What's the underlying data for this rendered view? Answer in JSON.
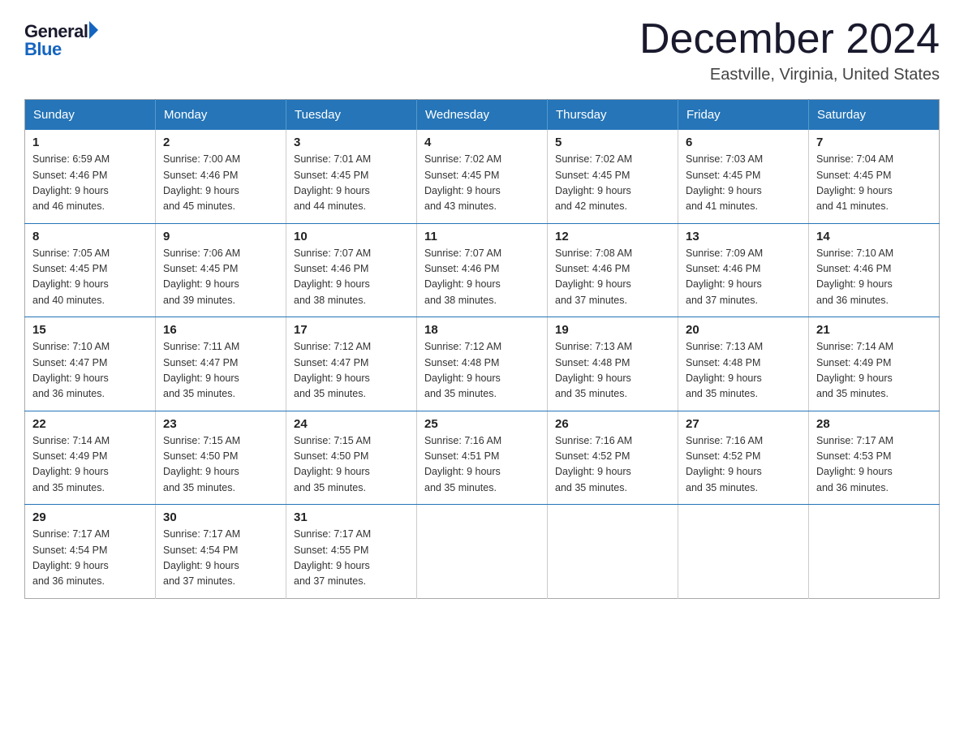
{
  "logo": {
    "general": "General",
    "blue": "Blue"
  },
  "title": "December 2024",
  "location": "Eastville, Virginia, United States",
  "weekdays": [
    "Sunday",
    "Monday",
    "Tuesday",
    "Wednesday",
    "Thursday",
    "Friday",
    "Saturday"
  ],
  "weeks": [
    [
      {
        "day": "1",
        "sunrise": "6:59 AM",
        "sunset": "4:46 PM",
        "daylight": "9 hours and 46 minutes."
      },
      {
        "day": "2",
        "sunrise": "7:00 AM",
        "sunset": "4:46 PM",
        "daylight": "9 hours and 45 minutes."
      },
      {
        "day": "3",
        "sunrise": "7:01 AM",
        "sunset": "4:45 PM",
        "daylight": "9 hours and 44 minutes."
      },
      {
        "day": "4",
        "sunrise": "7:02 AM",
        "sunset": "4:45 PM",
        "daylight": "9 hours and 43 minutes."
      },
      {
        "day": "5",
        "sunrise": "7:02 AM",
        "sunset": "4:45 PM",
        "daylight": "9 hours and 42 minutes."
      },
      {
        "day": "6",
        "sunrise": "7:03 AM",
        "sunset": "4:45 PM",
        "daylight": "9 hours and 41 minutes."
      },
      {
        "day": "7",
        "sunrise": "7:04 AM",
        "sunset": "4:45 PM",
        "daylight": "9 hours and 41 minutes."
      }
    ],
    [
      {
        "day": "8",
        "sunrise": "7:05 AM",
        "sunset": "4:45 PM",
        "daylight": "9 hours and 40 minutes."
      },
      {
        "day": "9",
        "sunrise": "7:06 AM",
        "sunset": "4:45 PM",
        "daylight": "9 hours and 39 minutes."
      },
      {
        "day": "10",
        "sunrise": "7:07 AM",
        "sunset": "4:46 PM",
        "daylight": "9 hours and 38 minutes."
      },
      {
        "day": "11",
        "sunrise": "7:07 AM",
        "sunset": "4:46 PM",
        "daylight": "9 hours and 38 minutes."
      },
      {
        "day": "12",
        "sunrise": "7:08 AM",
        "sunset": "4:46 PM",
        "daylight": "9 hours and 37 minutes."
      },
      {
        "day": "13",
        "sunrise": "7:09 AM",
        "sunset": "4:46 PM",
        "daylight": "9 hours and 37 minutes."
      },
      {
        "day": "14",
        "sunrise": "7:10 AM",
        "sunset": "4:46 PM",
        "daylight": "9 hours and 36 minutes."
      }
    ],
    [
      {
        "day": "15",
        "sunrise": "7:10 AM",
        "sunset": "4:47 PM",
        "daylight": "9 hours and 36 minutes."
      },
      {
        "day": "16",
        "sunrise": "7:11 AM",
        "sunset": "4:47 PM",
        "daylight": "9 hours and 35 minutes."
      },
      {
        "day": "17",
        "sunrise": "7:12 AM",
        "sunset": "4:47 PM",
        "daylight": "9 hours and 35 minutes."
      },
      {
        "day": "18",
        "sunrise": "7:12 AM",
        "sunset": "4:48 PM",
        "daylight": "9 hours and 35 minutes."
      },
      {
        "day": "19",
        "sunrise": "7:13 AM",
        "sunset": "4:48 PM",
        "daylight": "9 hours and 35 minutes."
      },
      {
        "day": "20",
        "sunrise": "7:13 AM",
        "sunset": "4:48 PM",
        "daylight": "9 hours and 35 minutes."
      },
      {
        "day": "21",
        "sunrise": "7:14 AM",
        "sunset": "4:49 PM",
        "daylight": "9 hours and 35 minutes."
      }
    ],
    [
      {
        "day": "22",
        "sunrise": "7:14 AM",
        "sunset": "4:49 PM",
        "daylight": "9 hours and 35 minutes."
      },
      {
        "day": "23",
        "sunrise": "7:15 AM",
        "sunset": "4:50 PM",
        "daylight": "9 hours and 35 minutes."
      },
      {
        "day": "24",
        "sunrise": "7:15 AM",
        "sunset": "4:50 PM",
        "daylight": "9 hours and 35 minutes."
      },
      {
        "day": "25",
        "sunrise": "7:16 AM",
        "sunset": "4:51 PM",
        "daylight": "9 hours and 35 minutes."
      },
      {
        "day": "26",
        "sunrise": "7:16 AM",
        "sunset": "4:52 PM",
        "daylight": "9 hours and 35 minutes."
      },
      {
        "day": "27",
        "sunrise": "7:16 AM",
        "sunset": "4:52 PM",
        "daylight": "9 hours and 35 minutes."
      },
      {
        "day": "28",
        "sunrise": "7:17 AM",
        "sunset": "4:53 PM",
        "daylight": "9 hours and 36 minutes."
      }
    ],
    [
      {
        "day": "29",
        "sunrise": "7:17 AM",
        "sunset": "4:54 PM",
        "daylight": "9 hours and 36 minutes."
      },
      {
        "day": "30",
        "sunrise": "7:17 AM",
        "sunset": "4:54 PM",
        "daylight": "9 hours and 37 minutes."
      },
      {
        "day": "31",
        "sunrise": "7:17 AM",
        "sunset": "4:55 PM",
        "daylight": "9 hours and 37 minutes."
      },
      null,
      null,
      null,
      null
    ]
  ],
  "labels": {
    "sunrise": "Sunrise: ",
    "sunset": "Sunset: ",
    "daylight": "Daylight: "
  }
}
